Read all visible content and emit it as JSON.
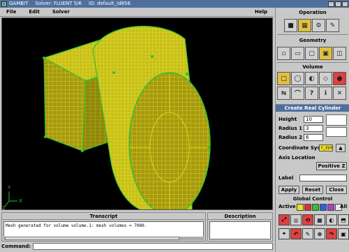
{
  "titlebar": {
    "app": "GAMBIT",
    "solver": "Solver: FLUENT 5/6",
    "id": "ID: default_id856"
  },
  "menu": {
    "file": "File",
    "edit": "Edit",
    "solver": "Solver",
    "help": "Help"
  },
  "viewport": {
    "axis_x": "X",
    "axis_y": "Y",
    "axis_z": "Z"
  },
  "transcript": {
    "title": "Transcript",
    "line": "Mesh generated for volume volume.1:    mesh volumes = 7080."
  },
  "description": {
    "title": "Description"
  },
  "command": {
    "label": "Command:",
    "value": ""
  },
  "panel": {
    "operation_title": "Operation",
    "geometry_title": "Geometry",
    "volume_title": "Volume",
    "form": {
      "title": "Create Real Cylinder",
      "height_label": "Height",
      "height_value": "10",
      "radius1_label": "Radius 1",
      "radius1_value": "3",
      "radius2_label": "Radius 2",
      "radius2_value": "6",
      "coord_label": "Coordinate Sys.",
      "coord_value": "c_sys",
      "axis_label": "Axis Location",
      "axis_value": "Positive Z",
      "label_label": "Label",
      "label_value": "",
      "apply": "Apply",
      "reset": "Reset",
      "close": "Close"
    },
    "global_title": "Global Control",
    "active_label": "Active",
    "all_label": "All"
  },
  "colors": {
    "mesh": "#e8e020",
    "edges": "#30c030",
    "title_bar": "#4f6f9f"
  }
}
